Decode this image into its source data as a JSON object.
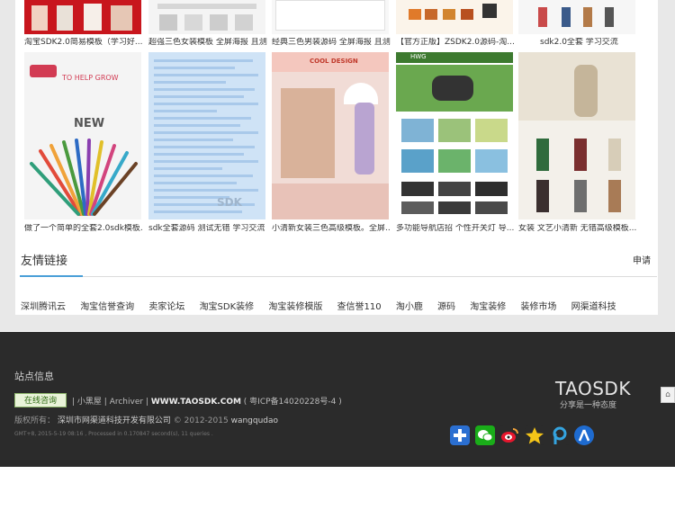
{
  "products_top_row": [
    {
      "caption": "淘宝SDK2.0简易模板（学习好..."
    },
    {
      "caption": "超强三色女装模板 全屏海报 且测..."
    },
    {
      "caption": "经典三色男装源码 全屏海报 且测..."
    },
    {
      "caption": "【官方正版】ZSDK2.0源码-淘..."
    },
    {
      "caption": "sdk2.0全套 学习交流"
    }
  ],
  "products_second_row": [
    {
      "caption": "做了一个简单的全套2.0sdk模板...",
      "banner_text": "TO HELP GROW",
      "big_text": "NEW"
    },
    {
      "caption": "sdk全套源码 测试无错 学习交流",
      "watermark": "SDK"
    },
    {
      "caption": "小清新女装三色高级模板。全屏...",
      "banner_text": "COOL DESIGN"
    },
    {
      "caption": "多功能导航店招 个性开关灯 导...",
      "banner_text": "HWG"
    },
    {
      "caption": "女装 文艺小清新 无错高级模板..."
    }
  ],
  "friend_links": {
    "title": "友情链接",
    "apply_label": "申请",
    "items": [
      "深圳腾讯云",
      "淘宝信誉查询",
      "卖家论坛",
      "淘宝SDK装修",
      "淘宝装修模版",
      "查信誉110",
      "淘小鹿",
      "源码",
      "淘宝装修",
      "装修市场",
      "网渠道科技"
    ]
  },
  "footer": {
    "section_title": "站点信息",
    "online_consult": "在线咨询",
    "links": [
      "小黑屋",
      "Archiver",
      "WWW.TAOSDK.COM",
      "粤ICP备14020228号-4"
    ],
    "copyright_prefix": "版权所有：",
    "company": "深圳市网渠道科技开发有限公司",
    "copyright_years": "© 2012-2015",
    "author": "wangqudao",
    "gmt_line": "GMT+8, 2015-5-19 08:16 , Processed in 0.170847 second(s), 11 queries .",
    "brand": "TAOSDK",
    "slogan": "分享是一种态度",
    "share_icons": [
      "plus-share",
      "wechat",
      "sina-weibo",
      "qzone",
      "pengyou",
      "renren"
    ],
    "side_tab": "⌂"
  }
}
